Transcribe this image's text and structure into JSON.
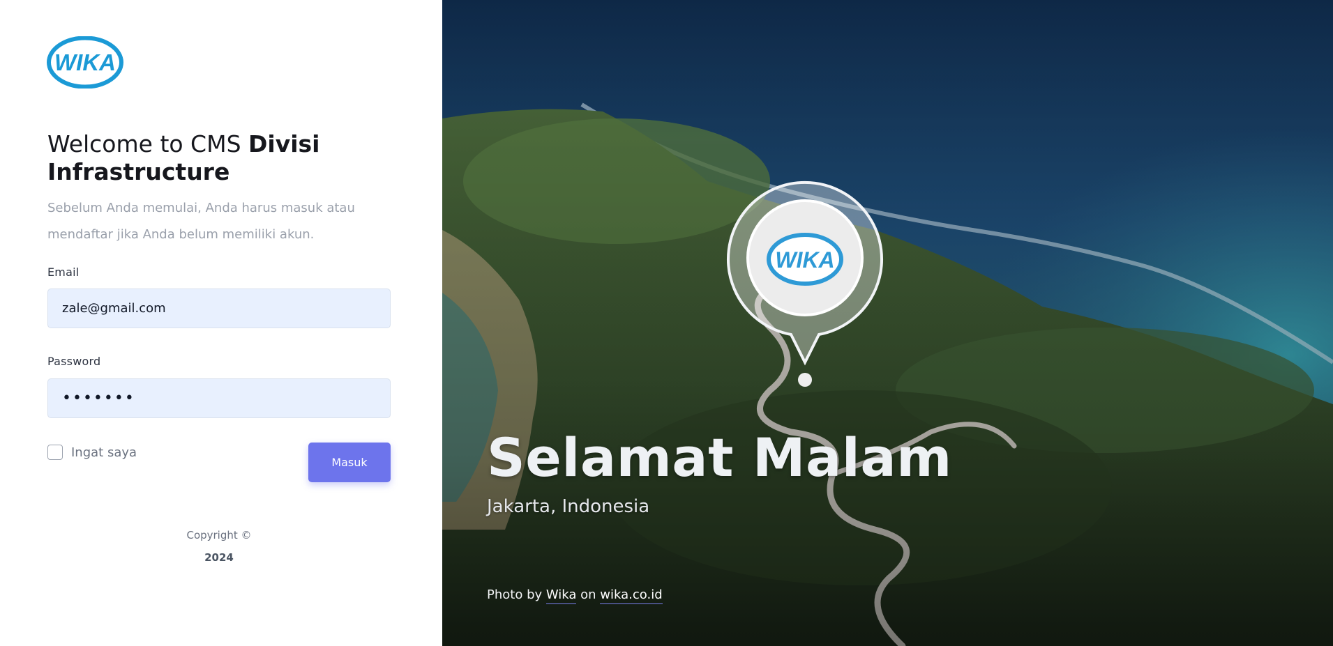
{
  "brand": {
    "logo_text": "WIKA",
    "accent": "#6d74ec",
    "logo_blue": "#1b9ad6"
  },
  "login": {
    "title_prefix": "Welcome to CMS ",
    "title_bold": "Divisi Infrastructure",
    "subtitle": "Sebelum Anda memulai, Anda harus masuk atau mendaftar jika Anda belum memiliki akun.",
    "email_label": "Email",
    "email_value": "zale@gmail.com",
    "password_label": "Password",
    "password_value": "•••••••",
    "remember_label": "Ingat saya",
    "submit_label": "Masuk"
  },
  "footer": {
    "copyright": "Copyright ©",
    "year": "2024"
  },
  "hero": {
    "greeting": "Selamat Malam",
    "location": "Jakarta, Indonesia",
    "credit_prefix": "Photo by ",
    "credit_author": "Wika",
    "credit_mid": " on ",
    "credit_site": "wika.co.id",
    "pin_logo_text": "WIKA"
  }
}
